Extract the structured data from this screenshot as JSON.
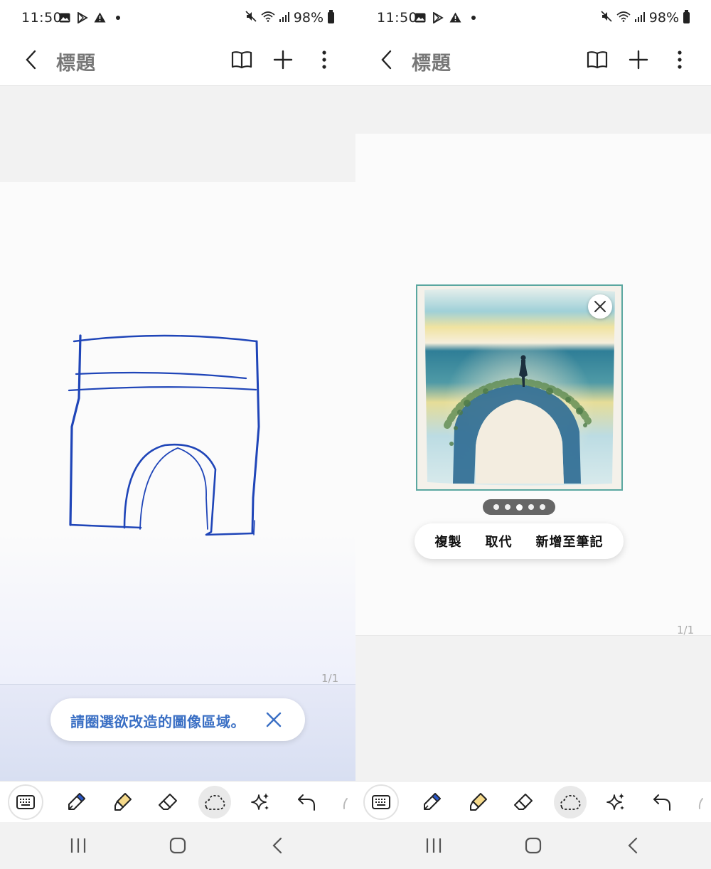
{
  "status_bar": {
    "time": "11:50",
    "battery": "98%"
  },
  "app_bar": {
    "title": "標題"
  },
  "left_screen": {
    "page_indicator": "1/1",
    "hint": {
      "text": "請圈選欲改造的圖像區域。"
    }
  },
  "right_screen": {
    "page_indicator": "1/1",
    "carousel": {
      "total": 5,
      "active_index": 2
    },
    "actions": {
      "copy": "複製",
      "replace": "取代",
      "add_to_note": "新增至筆記"
    }
  },
  "toolbar": {
    "tools": [
      "keyboard-icon",
      "pen-icon",
      "highlighter-icon",
      "eraser-icon",
      "lasso-icon",
      "ai-sparkle-icon",
      "undo-icon"
    ],
    "active_tool": "lasso-icon"
  },
  "colors": {
    "ink": "#1f45b8",
    "hint_text": "#3a6fc4",
    "accent_border": "#5aa7a0"
  }
}
